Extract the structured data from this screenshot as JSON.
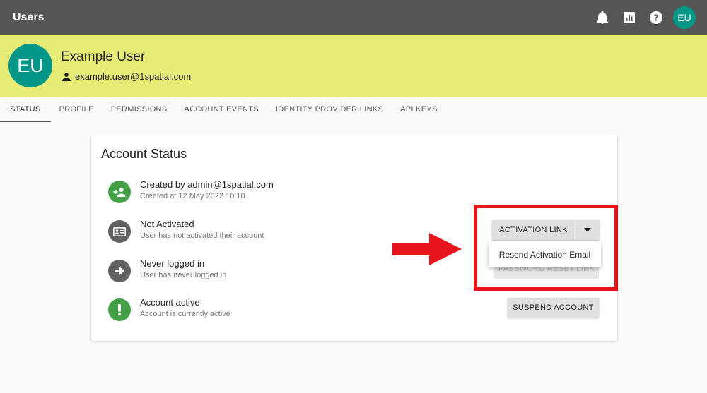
{
  "appbar": {
    "title": "Users",
    "avatar_initials": "EU",
    "icons": [
      "bell-icon",
      "bar-chart-icon",
      "help-icon"
    ]
  },
  "profile": {
    "initials": "EU",
    "name": "Example User",
    "email": "example.user@1spatial.com"
  },
  "tabs": [
    {
      "label": "STATUS",
      "active": true
    },
    {
      "label": "PROFILE",
      "active": false
    },
    {
      "label": "PERMISSIONS",
      "active": false
    },
    {
      "label": "ACCOUNT EVENTS",
      "active": false
    },
    {
      "label": "IDENTITY PROVIDER LINKS",
      "active": false
    },
    {
      "label": "API KEYS",
      "active": false
    }
  ],
  "card": {
    "title": "Account Status",
    "rows": [
      {
        "title": "Created by admin@1spatial.com",
        "subtitle": "Created at 12 May 2022 10:10",
        "icon": "person-add-icon",
        "color": "#43a047"
      },
      {
        "title": "Not Activated",
        "subtitle": "User has not activated their account",
        "icon": "id-card-icon",
        "color": "#616161"
      },
      {
        "title": "Never logged in",
        "subtitle": "User has never logged in",
        "icon": "arrow-right-icon",
        "color": "#616161"
      },
      {
        "title": "Account active",
        "subtitle": "Account is currently active",
        "icon": "exclamation-icon",
        "color": "#43a047"
      }
    ],
    "buttons": {
      "activation_link": "ACTIVATION LINK",
      "password_reset": "PASSWORD RESET LINK",
      "suspend": "SUSPEND ACCOUNT"
    },
    "menu": {
      "resend": "Resend Activation Email"
    }
  },
  "colors": {
    "appbar": "#555555",
    "profile_bg": "#e6ec76",
    "avatar": "#009688",
    "highlight": "#e8141c"
  }
}
